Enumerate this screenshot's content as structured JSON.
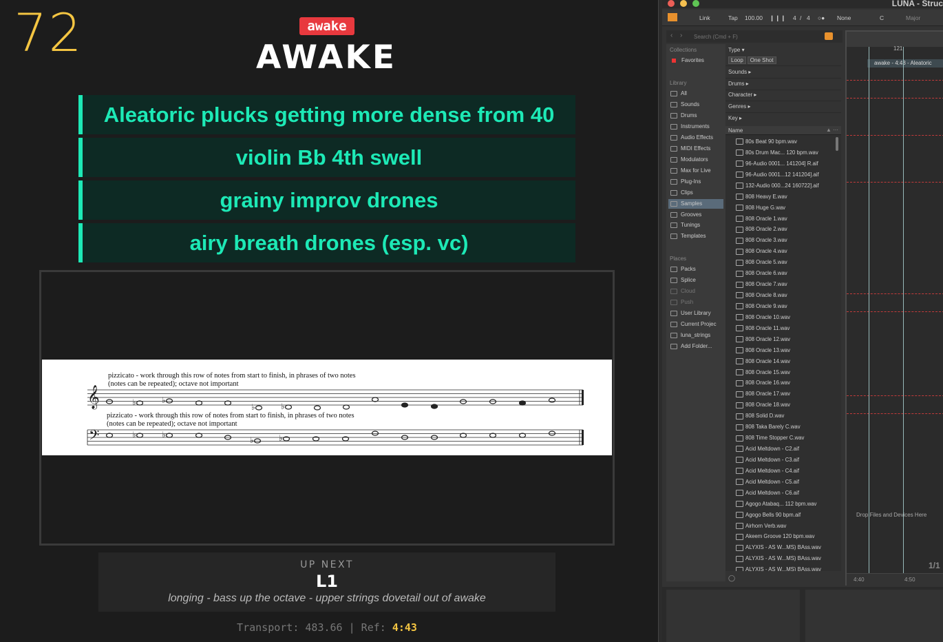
{
  "cue_display": {
    "bar_number": "72",
    "section_badge": "awake",
    "section_title": "AWAKE",
    "cues": [
      "Aleatoric plucks getting more dense from 40",
      "violin Bb 4th swell",
      "grainy improv drones",
      "airy breath drones (esp. vc)"
    ],
    "score": {
      "treble_instruction_1": "pizzicato - work through this row of notes from start to finish, in phrases of two notes",
      "treble_instruction_2": "(notes can be repeated); octave not important",
      "bass_instruction_1": "pizzicato - work through this row of notes from start to finish, in phrases of two notes",
      "bass_instruction_2": "(notes can be repeated); octave not important"
    },
    "up_next": {
      "label": "UP NEXT",
      "cue": "L1",
      "description": "longing - bass up the octave - upper strings dovetail out of awake"
    },
    "transport": {
      "label": "Transport:",
      "value": "483.66",
      "separator": "|",
      "ref_label": "Ref:",
      "ref_value": "4:43"
    },
    "colors": {
      "accent": "#1de9b6",
      "bar_number": "#f4c542",
      "badge": "#e8393e"
    }
  },
  "daw": {
    "title": "LUNA - Struc",
    "toolbar": {
      "link": "Link",
      "tap": "Tap",
      "tempo": "100.00",
      "sig_num": "4",
      "sig_slash": "/",
      "sig_den": "4",
      "quantize": "None",
      "key": "C",
      "scale": "Major"
    },
    "search_placeholder": "Search (Cmd + F)",
    "sidebar": {
      "collections_label": "Collections",
      "favorites": "Favorites",
      "library_label": "Library",
      "library": [
        "All",
        "Sounds",
        "Drums",
        "Instruments",
        "Audio Effects",
        "MIDI Effects",
        "Modulators",
        "Max for Live",
        "Plug-Ins",
        "Clips",
        "Samples",
        "Grooves",
        "Tunings",
        "Templates"
      ],
      "places_label": "Places",
      "places": [
        "Packs",
        "Splice",
        "Cloud",
        "Push",
        "User Library",
        "Current Projec",
        "luna_strings",
        "Add Folder..."
      ]
    },
    "filters": {
      "type_label": "Type",
      "loop": "Loop",
      "one_shot": "One Shot",
      "rows": [
        "Sounds",
        "Drums",
        "Character",
        "Genres",
        "Key"
      ]
    },
    "file_list": {
      "header": "Name",
      "files": [
        "80s Beat 90 bpm.wav",
        "80s Drum Mac... 120 bpm.wav",
        "96-Audio 0001... 141204] R.aif",
        "96-Audio 0001...12 141204].aif",
        "132-Audio 000...24 160722].aif",
        "808 Heavy E.wav",
        "808 Huge G.wav",
        "808 Oracle 1.wav",
        "808 Oracle 2.wav",
        "808 Oracle 3.wav",
        "808 Oracle 4.wav",
        "808 Oracle 5.wav",
        "808 Oracle 6.wav",
        "808 Oracle 7.wav",
        "808 Oracle 8.wav",
        "808 Oracle 9.wav",
        "808 Oracle 10.wav",
        "808 Oracle 11.wav",
        "808 Oracle 12.wav",
        "808 Oracle 13.wav",
        "808 Oracle 14.wav",
        "808 Oracle 15.wav",
        "808 Oracle 16.wav",
        "808 Oracle 17.wav",
        "808 Oracle 18.wav",
        "808 Solid D.wav",
        "808 Taka Barely C.wav",
        "808 Time Stopper C.wav",
        "Acid Meltdown - C2.aif",
        "Acid Meltdown - C3.aif",
        "Acid Meltdown - C4.aif",
        "Acid Meltdown - C5.aif",
        "Acid Meltdown - C6.aif",
        "Agogo Atabaq... 112 bpm.wav",
        "Agogo Bells 90 bpm.aif",
        "Airhorn Verb.wav",
        "Akeem Groove 120 bpm.wav",
        "ALYXIS - AS W...MS) BAss.wav",
        "ALYXIS - AS W...MS) BAss.wav",
        "ALYXIS - AS W...MS) BAss.wav"
      ]
    },
    "arrangement": {
      "ruler_marker": "121",
      "clip_label": "awake - 4:43 - Aleatoric",
      "drop_text": "Drop Files and Devices Here",
      "time_left": "4:40",
      "time_right": "4:50",
      "fraction": "1/1"
    }
  }
}
